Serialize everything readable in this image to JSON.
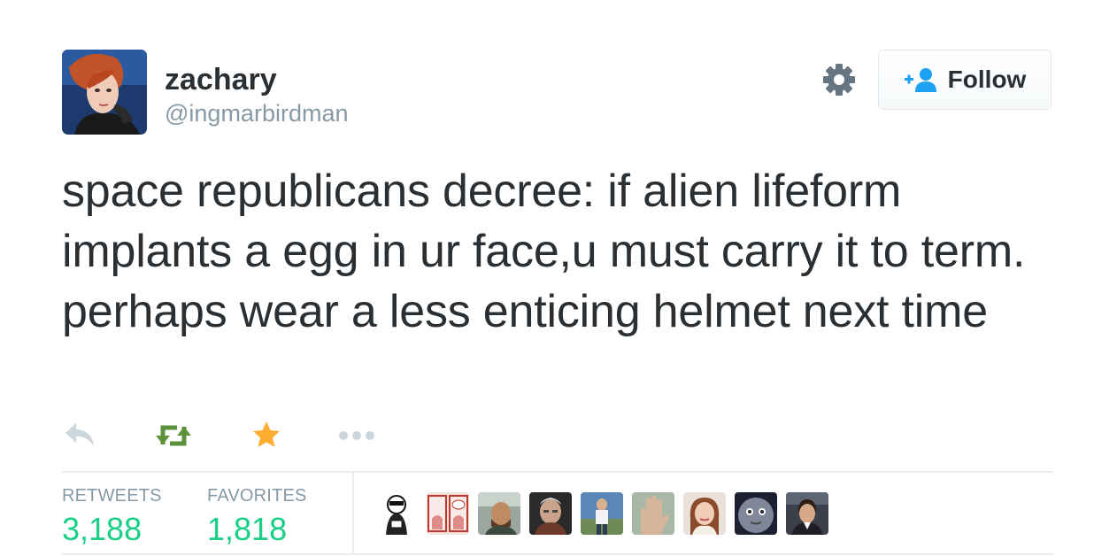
{
  "user": {
    "display_name": "zachary",
    "handle": "@ingmarbirdman",
    "avatar_icon": "user-avatar"
  },
  "header": {
    "settings_icon": "gear-icon",
    "follow_label": "Follow",
    "follow_icon": "add-user-icon"
  },
  "tweet": {
    "text": "space republicans decree: if alien lifeform implants a egg in ur face,u must carry it to term. perhaps wear a less enticing helmet next time"
  },
  "actions": [
    {
      "name": "reply",
      "icon": "reply-icon",
      "color": "#ccd6dd"
    },
    {
      "name": "retweet",
      "icon": "retweet-icon",
      "color": "#5c913b"
    },
    {
      "name": "favorite",
      "icon": "star-icon",
      "color": "#ffac33"
    },
    {
      "name": "more",
      "icon": "more-icon",
      "color": "#ccd6dd"
    }
  ],
  "stats": {
    "retweets_label": "RETWEETS",
    "retweets_value": "3,188",
    "favorites_label": "FAVORITES",
    "favorites_value": "1,818"
  },
  "colors": {
    "text": "#292f33",
    "muted": "#8899a6",
    "stat_value": "#19cf86",
    "border": "#e1e8ed"
  }
}
